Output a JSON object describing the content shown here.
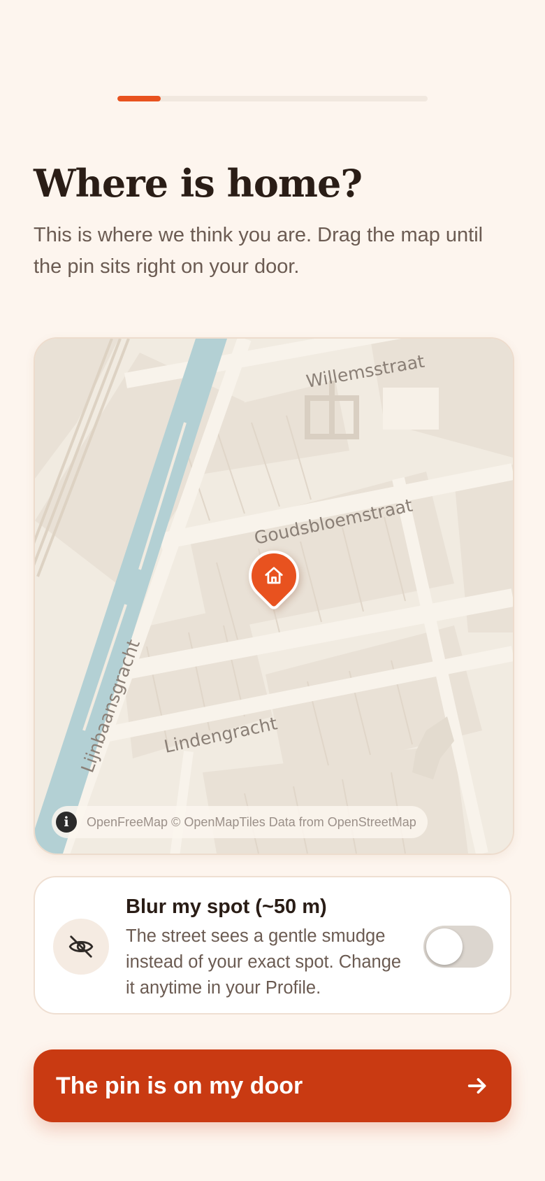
{
  "progress": {
    "step": 1,
    "fraction": 0.14,
    "fill_color": "#e8521f"
  },
  "header": {
    "title": "Where is home?",
    "subtitle": "This is where we think you are. Drag the map until the pin sits right on your door."
  },
  "map": {
    "streets": {
      "willemsstraat": "Willemsstraat",
      "goudsbloemstraat": "Goudsbloemstraat",
      "lijnbaansgracht": "Lijnbaansgracht",
      "lindengracht": "Lindengracht"
    },
    "pin_icon": "home-icon",
    "attribution": "OpenFreeMap © OpenMapTiles Data from OpenStreetMap",
    "info_icon": "i"
  },
  "blur": {
    "title": "Blur my spot (~50 m)",
    "description": "The street sees a gentle smudge instead of your exact spot. Change it anytime in your Profile.",
    "icon": "eye-off-icon",
    "enabled": false
  },
  "cta": {
    "label": "The pin is on my door",
    "icon": "arrow-right-icon",
    "color": "#c93a12"
  },
  "colors": {
    "accent": "#e8521f",
    "background": "#fdf5ee",
    "text": "#2a1d16"
  }
}
